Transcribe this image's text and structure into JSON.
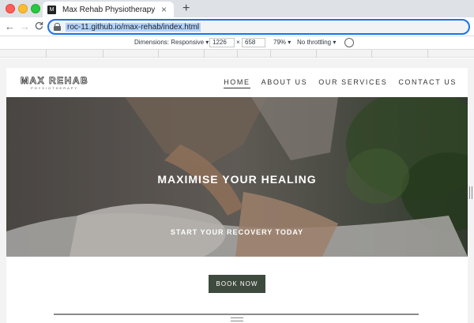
{
  "browser": {
    "tab_title": "Max Rehab Physiotherapy",
    "favicon_text": "M",
    "tab_close": "×",
    "new_tab": "+",
    "back": "←",
    "forward": "→",
    "reload": "C",
    "url": "roc-11.github.io/max-rehab/index.html"
  },
  "devtools": {
    "dimensions_label": "Dimensions: Responsive",
    "width": "1226",
    "times": "×",
    "height": "658",
    "zoom": "79%",
    "throttling": "No throttling"
  },
  "site": {
    "logo": "MAX REHAB",
    "logo_sub": "PHYSIOTHERAPY",
    "nav": [
      "HOME",
      "ABOUT US",
      "OUR SERVICES",
      "CONTACT US"
    ],
    "active_nav": "HOME",
    "hero_title": "MAXIMISE YOUR HEALING",
    "hero_subtitle": "START YOUR RECOVERY TODAY",
    "cta": "BOOK NOW"
  },
  "colors": {
    "button_bg": "#3f4a3e",
    "omnibox_focus": "#1a73e8"
  }
}
